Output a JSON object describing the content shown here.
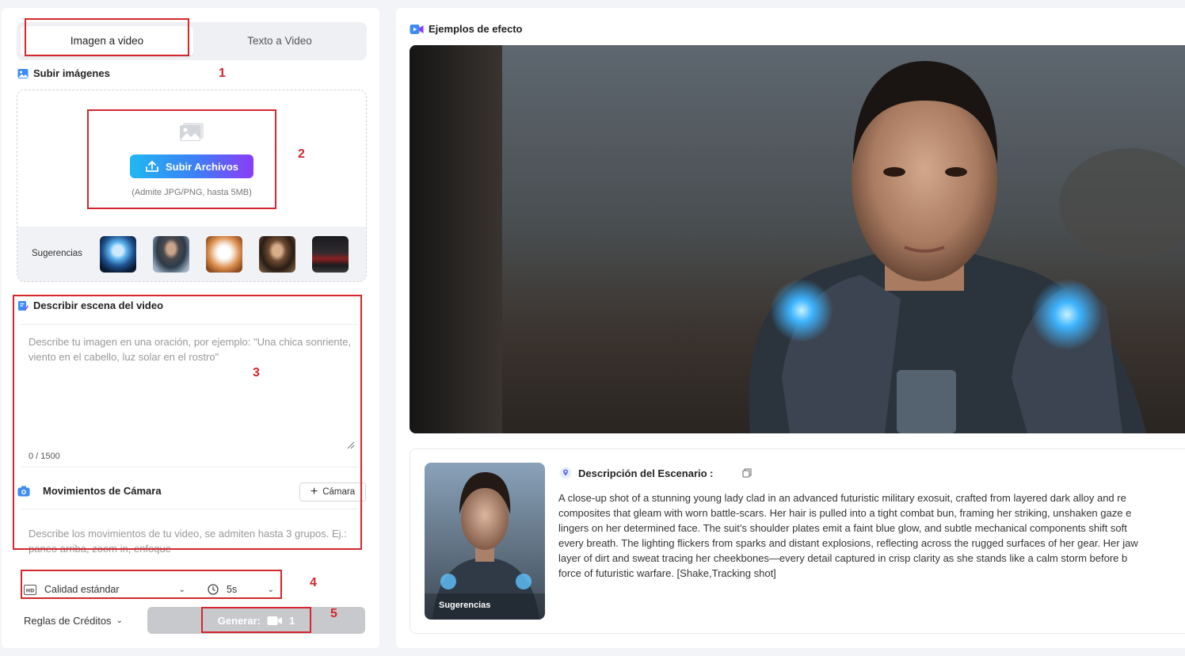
{
  "tabs": {
    "image_to_video": "Imagen a video",
    "text_to_video": "Texto a Video"
  },
  "upload": {
    "section_title": "Subir imágenes",
    "button_label": "Subir Archivos",
    "hint": "(Admite JPG/PNG, hasta 5MB)",
    "suggestions_label": "Sugerencias"
  },
  "describe": {
    "section_title": "Describir escena del video",
    "placeholder": "Describe tu imagen en una oración, por ejemplo: \"Una chica sonriente, viento en el cabello, luz solar en el rostro\"",
    "counter": "0 / 1500"
  },
  "camera": {
    "section_title": "Movimientos de Cámara",
    "add_button": "Cámara",
    "placeholder": "Describe los movimientos de tu video, se admiten hasta 3 grupos. Ej.: paneo arriba, zoom in, enfoque"
  },
  "settings": {
    "quality": "Calidad estándar",
    "duration": "5s",
    "credits_rules": "Reglas de Créditos",
    "generate_label": "Generar:",
    "generate_cost": "1"
  },
  "annotations": [
    "1",
    "2",
    "3",
    "4",
    "5"
  ],
  "examples": {
    "title": "Ejemplos de efecto",
    "scene_title": "Descripción del Escenario :",
    "thumb_label": "Sugerencias",
    "scene_lines": [
      "A close-up shot of a stunning young lady clad in an advanced futuristic military exosuit, crafted from layered dark alloy and re",
      "composites that gleam with worn battle-scars. Her hair is pulled into a tight combat bun, framing her striking, unshaken gaze e",
      "lingers on her determined face. The suit’s shoulder plates emit a faint blue glow, and subtle mechanical components shift soft",
      "every breath. The lighting flickers from sparks and distant explosions, reflecting across the rugged surfaces of her gear. Her jaw",
      "layer of dirt and sweat tracing her cheekbones—every detail captured in crisp clarity as she stands like a calm storm before b",
      "force of futuristic warfare. [Shake,Tracking shot]"
    ]
  },
  "colors": {
    "accent_gradient_start": "#1fb8f2",
    "accent_gradient_end": "#8b3cf6",
    "annotation_red": "#d4262c"
  }
}
